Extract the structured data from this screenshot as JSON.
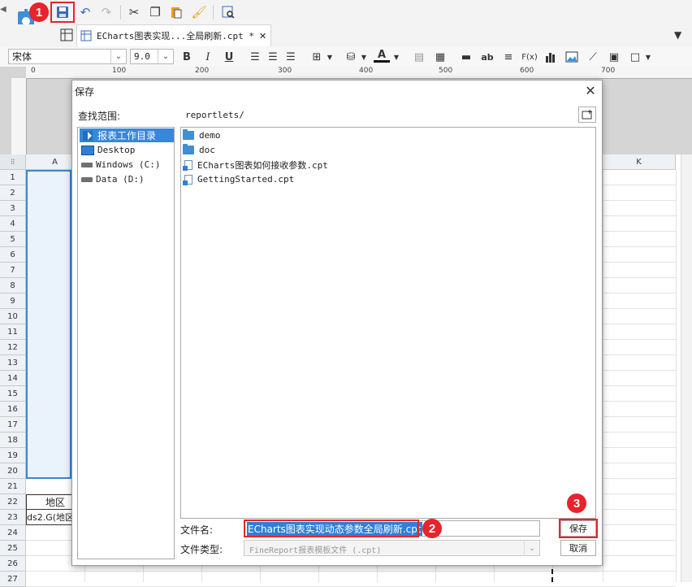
{
  "file_tab": {
    "title": "ECharts图表实现...全局刷新.cpt *",
    "close": "✕"
  },
  "format": {
    "font": "宋体",
    "size": "9.0",
    "bold": "B",
    "italic": "I",
    "underline": "U",
    "text_color": "A",
    "text_abbr": "ab",
    "formula": "F(x)"
  },
  "ruler": {
    "marks": [
      "0",
      "100",
      "200",
      "300",
      "400",
      "500",
      "600",
      "700"
    ]
  },
  "sheet": {
    "col_a": "A",
    "col_k": "K",
    "rows": [
      "1",
      "2",
      "3",
      "4",
      "5",
      "6",
      "7",
      "8",
      "9",
      "10",
      "11",
      "12",
      "13",
      "14",
      "15",
      "16",
      "17",
      "18",
      "19",
      "20",
      "21",
      "22",
      "23",
      "24",
      "25",
      "26",
      "27"
    ],
    "cell_a22": "地区",
    "cell_a23": "ds2.G(地区"
  },
  "dialog": {
    "title": "保存",
    "close": "✕",
    "lookin_label": "查找范围:",
    "path": "reportlets/",
    "nav": [
      "报表工作目录",
      "Desktop",
      "Windows (C:)",
      "Data (D:)"
    ],
    "files": [
      "demo",
      "doc",
      "ECharts图表如何接收参数.cpt",
      "GettingStarted.cpt"
    ],
    "filename_label": "文件名:",
    "filename_value": "ECharts图表实现动态参数全局刷新.cpt",
    "filetype_label": "文件类型:",
    "filetype_value": "FineReport报表模板文件 (.cpt)",
    "save_button": "保存",
    "cancel_button": "取消"
  },
  "annotations": {
    "step1": "1",
    "step2": "2",
    "step3": "3"
  },
  "colors": {
    "accent": "#3d8fd8",
    "selection": "#3a86d8",
    "annotation_red": "#e8232b"
  }
}
